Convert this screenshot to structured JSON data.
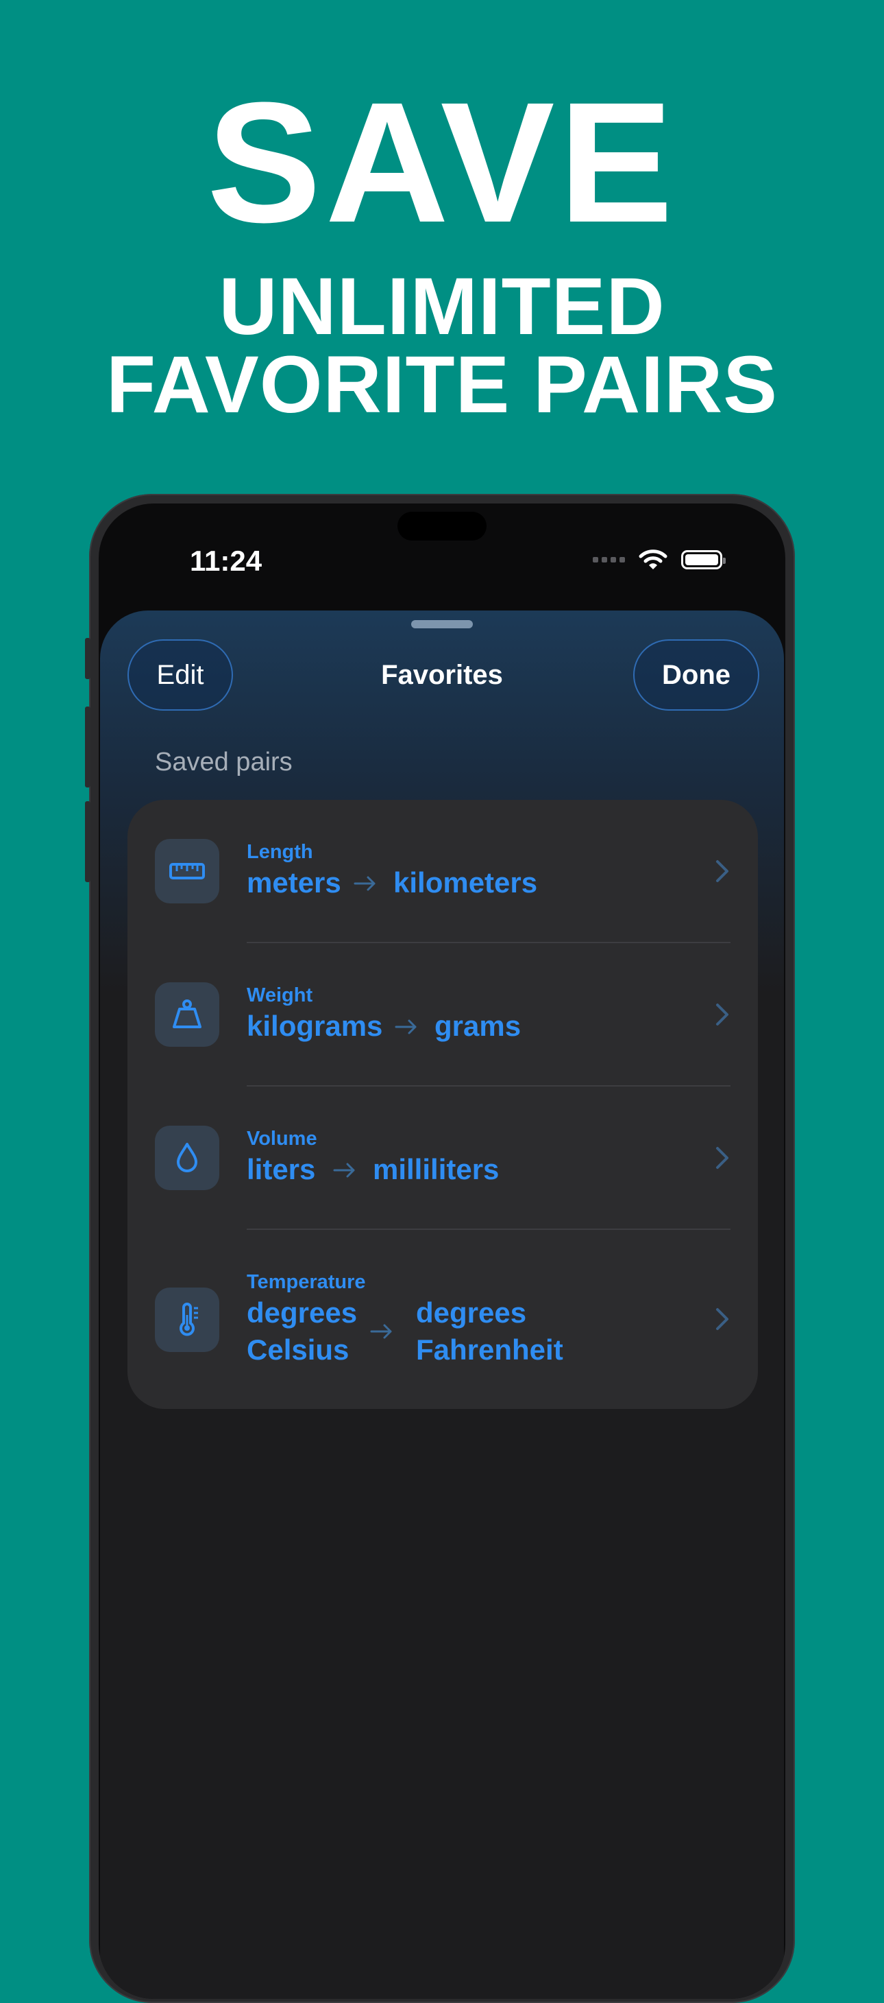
{
  "headline": {
    "title": "SAVE",
    "subtitle_line1": "UNLIMITED",
    "subtitle_line2": "FAVORITE PAIRS"
  },
  "status_bar": {
    "time": "11:24",
    "icons": [
      "signal-icon",
      "wifi-icon",
      "battery-icon"
    ]
  },
  "nav": {
    "edit_label": "Edit",
    "title": "Favorites",
    "done_label": "Done"
  },
  "section_title": "Saved pairs",
  "colors": {
    "background": "#008F83",
    "accent": "#2F8DF2",
    "card": "#2C2C2E"
  },
  "favorites": [
    {
      "category": "Length",
      "from": "meters",
      "to": "kilometers",
      "icon": "ruler-icon"
    },
    {
      "category": "Weight",
      "from": "kilograms",
      "to": "grams",
      "icon": "weight-icon"
    },
    {
      "category": "Volume",
      "from": "liters",
      "to": "milliliters",
      "icon": "drop-icon"
    },
    {
      "category": "Temperature",
      "from_line1": "degrees",
      "from_line2": "Celsius",
      "to_line1": "degrees",
      "to_line2": "Fahrenheit",
      "icon": "thermometer-icon"
    }
  ]
}
